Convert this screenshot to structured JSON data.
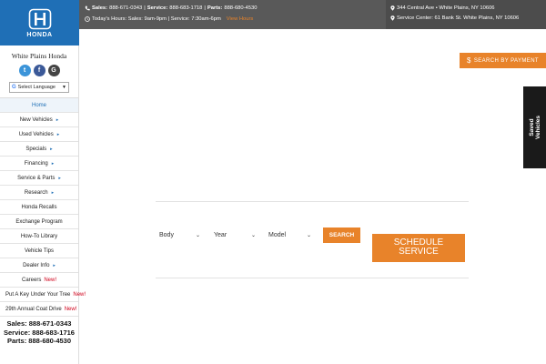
{
  "sidebar": {
    "logo_text": "HONDA",
    "dealer_name": "White Plains Honda",
    "social": {
      "twitter": "t",
      "facebook": "f",
      "google": "G"
    },
    "language": {
      "icon": "G",
      "label": "Select Language",
      "arrow": "▼"
    },
    "menu": [
      {
        "label": "Home",
        "caret": "",
        "new": ""
      },
      {
        "label": "New Vehicles",
        "caret": "▸",
        "new": ""
      },
      {
        "label": "Used Vehicles",
        "caret": "▸",
        "new": ""
      },
      {
        "label": "Specials",
        "caret": "▸",
        "new": ""
      },
      {
        "label": "Financing",
        "caret": "▸",
        "new": ""
      },
      {
        "label": "Service & Parts",
        "caret": "▸",
        "new": ""
      },
      {
        "label": "Research",
        "caret": "▸",
        "new": ""
      },
      {
        "label": "Honda Recalls",
        "caret": "",
        "new": ""
      },
      {
        "label": "Exchange Program",
        "caret": "",
        "new": ""
      },
      {
        "label": "How-To Library",
        "caret": "",
        "new": ""
      },
      {
        "label": "Vehicle Tips",
        "caret": "",
        "new": ""
      },
      {
        "label": "Dealer Info",
        "caret": "▸",
        "new": ""
      },
      {
        "label": "Careers",
        "caret": "",
        "new": "New!"
      },
      {
        "label": "Put A Key Under Your Tree",
        "caret": "",
        "new": "New!"
      },
      {
        "label": "29th Annual Coat Drive",
        "caret": "",
        "new": "New!"
      }
    ],
    "contact": [
      "Sales: 888-671-0343",
      "Service: 888-683-1716",
      "Parts: 888-680-4530"
    ]
  },
  "topbar": {
    "sales_label": "Sales:",
    "sales_phone": "888-671-0343",
    "service_label": "Service:",
    "service_phone": "888-683-1718",
    "parts_label": "Parts:",
    "parts_phone": "888-680-4530",
    "sep": "|",
    "hours": "Today's Hours: Sales: 9am-9pm | Service: 7:30am-6pm",
    "view_hours": "View Hours",
    "address": "344 Central Ave • White Plains, NY 10606",
    "service_center": "Service Center: 61 Bank St. White Plains, NY 10606"
  },
  "actions": {
    "search_by_payment": "SEARCH BY PAYMENT",
    "dollar": "$",
    "saved_vehicles_line1": "Saved",
    "saved_vehicles_line2": "Vehicles"
  },
  "search_form": {
    "body": "Body",
    "year": "Year",
    "model": "Model",
    "chevron": "⌄",
    "search": "SEARCH",
    "schedule_line1": "SCHEDULE",
    "schedule_line2": "SERVICE"
  },
  "colors": {
    "brand_blue": "#1f6fb6",
    "accent_orange": "#e8832a",
    "topbar_gray": "#595959"
  }
}
